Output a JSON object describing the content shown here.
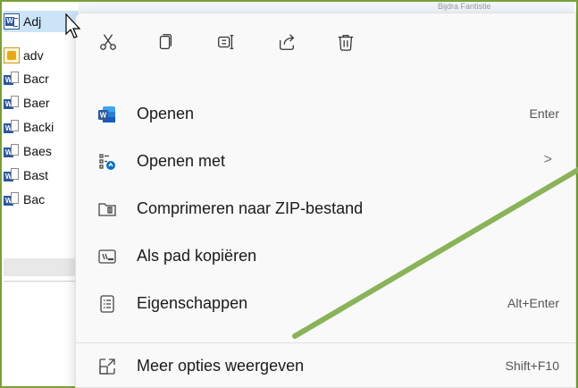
{
  "explorer": {
    "files": [
      {
        "name": "Adj",
        "icon": "word-doc-icon",
        "selected": true
      },
      {
        "name": "adv",
        "icon": "pdf-file-icon"
      },
      {
        "name": "Bacr",
        "icon": "word-backup-icon"
      },
      {
        "name": "Baer",
        "icon": "word-backup-icon"
      },
      {
        "name": "Backi",
        "icon": "word-backup-icon"
      },
      {
        "name": "Baes",
        "icon": "word-backup-icon"
      },
      {
        "name": "Bast",
        "icon": "word-backup-icon"
      },
      {
        "name": "Bac",
        "icon": "word-backup-icon"
      }
    ],
    "column_header": "Bijdra Fantistie"
  },
  "context_menu": {
    "quick_actions": [
      {
        "name": "cut",
        "icon": "scissors-icon"
      },
      {
        "name": "copy",
        "icon": "copy-icon"
      },
      {
        "name": "rename",
        "icon": "rename-icon"
      },
      {
        "name": "share",
        "icon": "share-icon"
      },
      {
        "name": "delete",
        "icon": "trash-icon"
      }
    ],
    "items": [
      {
        "label": "Openen",
        "shortcut": "Enter",
        "icon": "word-app-icon"
      },
      {
        "label": "Openen met",
        "shortcut": "",
        "submenu": ">",
        "icon": "open-with-icon"
      },
      {
        "label": "Comprimeren naar ZIP-bestand",
        "shortcut": "",
        "icon": "zip-folder-icon"
      },
      {
        "label": "Als pad kopiëren",
        "shortcut": "",
        "icon": "copy-path-icon"
      },
      {
        "label": "Eigenschappen",
        "shortcut": "Alt+Enter",
        "icon": "properties-icon"
      },
      {
        "label": "Meer opties weergeven",
        "shortcut": "Shift+F10",
        "icon": "more-options-icon"
      }
    ]
  },
  "colors": {
    "annotation_arrow": "#8ab35a",
    "frame_border": "#7aa03a",
    "selection": "#cce4f7",
    "word_blue": "#2b579a"
  }
}
